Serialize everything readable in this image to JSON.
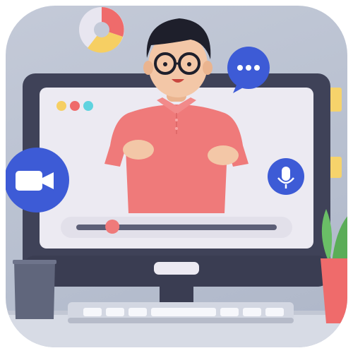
{
  "scene": {
    "subject": "video-conference-illustration",
    "colors": {
      "background": "#bcc3d2",
      "monitor_bezel": "#3f4258",
      "screen": "#eceaf2",
      "shirt": "#ef7a7a",
      "skin": "#f3c7a7",
      "hair": "#1e1f2b",
      "accent_blue": "#3d5bd6",
      "pie_red": "#ef6b6b",
      "pie_yellow": "#f6cf63",
      "pie_light": "#e8e6f0",
      "window_dot_yellow": "#f6cf63",
      "window_dot_red": "#ef6b6b",
      "window_dot_teal": "#5fd3df",
      "plant_leaf": "#6abf66",
      "plant_pot": "#ef6b6b",
      "cup": "#60667c",
      "sticky_note": "#f6d36b"
    },
    "icons": [
      "video-camera-icon",
      "microphone-icon",
      "chat-bubble-icon",
      "pie-chart-icon"
    ],
    "video_progress": 0.18
  }
}
